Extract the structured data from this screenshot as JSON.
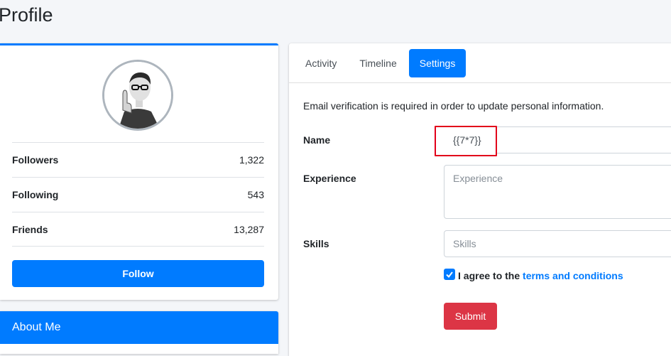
{
  "page": {
    "title": "Profile"
  },
  "profile": {
    "stats": [
      {
        "label": "Followers",
        "value": "1,322"
      },
      {
        "label": "Following",
        "value": "543"
      },
      {
        "label": "Friends",
        "value": "13,287"
      }
    ],
    "follow_label": "Follow"
  },
  "about": {
    "title": "About Me"
  },
  "tabs": [
    {
      "label": "Activity",
      "active": false
    },
    {
      "label": "Timeline",
      "active": false
    },
    {
      "label": "Settings",
      "active": true
    }
  ],
  "settings": {
    "notice": "Email verification is required in order to update personal information.",
    "name_label": "Name",
    "name_value": "{{7*7}}",
    "experience_label": "Experience",
    "experience_placeholder": "Experience",
    "skills_label": "Skills",
    "skills_placeholder": "Skills",
    "agree_text": "I agree to the",
    "terms_link": "terms and conditions",
    "submit_label": "Submit"
  },
  "colors": {
    "primary": "#007bff",
    "danger": "#dc3545",
    "highlight": "#e2001a"
  }
}
